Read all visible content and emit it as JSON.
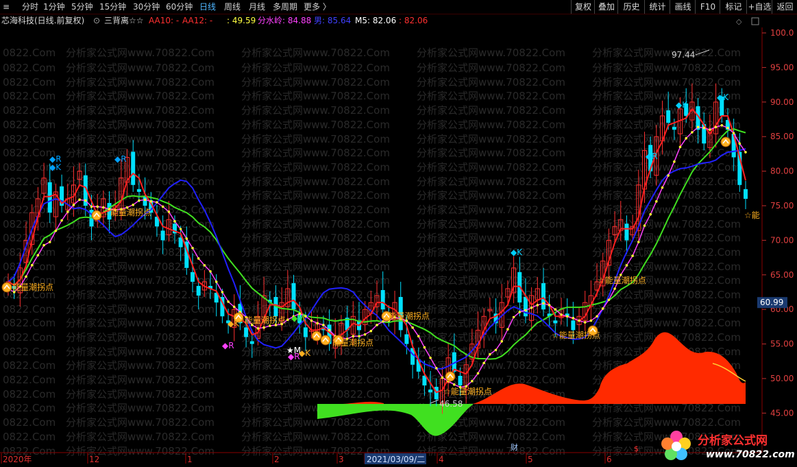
{
  "toolbar": {
    "tabs": [
      {
        "label": "分时",
        "active": false
      },
      {
        "label": "1分钟",
        "active": false
      },
      {
        "label": "5分钟",
        "active": false
      },
      {
        "label": "15分钟",
        "active": false
      },
      {
        "label": "30分钟",
        "active": false
      },
      {
        "label": "60分钟",
        "active": false
      },
      {
        "label": "日线",
        "active": true
      },
      {
        "label": "周线",
        "active": false
      },
      {
        "label": "月线",
        "active": false
      },
      {
        "label": "多周期",
        "active": false
      },
      {
        "label": "更多 〉",
        "active": false
      }
    ],
    "right_buttons": [
      "复权",
      "叠加",
      "历史",
      "统计",
      "画线",
      "F10",
      "标记",
      "+自选",
      "返回"
    ]
  },
  "info": {
    "stock": "芯海科技(日线.前复权)",
    "indicator": "三背离☆☆",
    "aa10": "AA10: -",
    "aa12": "AA12: -",
    "val1": ": 49.59",
    "fsl": "分水岭: 84.88",
    "v3": "男: 85.64",
    "m5": "M5: 82.06",
    "m5b": ": 82.06",
    "colors": {
      "stock": "#d8d8d8",
      "aa10": "#ff3030",
      "aa12": "#ff3030",
      "val1": "#ffff40",
      "fsl": "#ff40ff",
      "v3": "#4040ff",
      "m5": "#ffffff",
      "m5b": "#ff3030"
    }
  },
  "axis": {
    "ticks": [
      "100.0",
      "95.00",
      "90.00",
      "85.00",
      "80.00",
      "75.00",
      "70.00",
      "65.00",
      "60.00",
      "55.00",
      "50.00",
      "45.00"
    ],
    "current_price": "60.99",
    "y_range": [
      44,
      101
    ]
  },
  "dates": {
    "labels": [
      "2020年",
      "12",
      "1",
      "2",
      "3",
      "2021/03/09/二",
      "4",
      "5",
      "6"
    ],
    "markers": {
      "fin": "财",
      "s": "$"
    }
  },
  "annotations": {
    "high": "97.44",
    "low": "46.58",
    "turning_point": "能量潮拐点",
    "star_turning_point": "☆能量潮拐点",
    "marks": [
      "◆R",
      "◆K",
      "◆R",
      "◆R",
      "◆K",
      "◆M",
      "★M",
      "◆K",
      "◆R",
      "◆K",
      "◆K",
      "◆R",
      "◆K",
      "☆能"
    ]
  },
  "watermark": {
    "text": "分析家公式网www.70822.Com",
    "text_left": "0822.Com"
  },
  "logo": {
    "name": "分析家公式网",
    "url": "www.70822.com"
  },
  "colors": {
    "up": "#ff3030",
    "down": "#00e0ff",
    "grid": "#5a0000",
    "blue": "#2020ff",
    "green": "#40e020",
    "red": "#ff2020",
    "fill_red": "#ff2a00",
    "fill_green": "#40e020",
    "yellow": "#ffff30",
    "magenta": "#ff40ff"
  },
  "chart_data": {
    "type": "candlestick",
    "title": "芯海科技(日线.前复权)",
    "ylim": [
      44,
      101
    ],
    "x_labels": [
      "2020年",
      "12",
      "1",
      "2",
      "3",
      "2021/03/09/二",
      "4",
      "5",
      "6"
    ],
    "close": [
      64,
      63,
      66,
      70,
      74,
      76,
      79,
      74,
      77,
      75,
      76,
      78,
      80,
      75,
      72,
      74,
      76,
      73,
      75,
      79,
      82,
      78,
      77,
      75,
      74,
      72,
      70,
      73,
      71,
      69,
      66,
      64,
      62,
      64,
      63,
      61,
      59,
      58,
      60,
      58,
      56,
      55,
      59,
      62,
      61,
      59,
      61,
      63,
      60,
      58,
      56,
      57,
      58,
      57,
      55,
      56,
      58,
      57,
      59,
      57,
      60,
      61,
      62,
      60,
      59,
      61,
      57,
      55,
      52,
      51,
      49,
      48,
      47,
      50,
      53,
      51,
      49,
      52,
      55,
      57,
      59,
      60,
      58,
      61,
      63,
      66,
      61,
      59,
      62,
      63,
      60,
      59,
      58,
      60,
      59,
      57,
      59,
      61,
      62,
      64,
      67,
      70,
      72,
      73,
      70,
      72,
      78,
      83,
      80,
      85,
      88,
      87,
      86,
      89,
      88,
      90,
      86,
      84,
      86,
      90,
      88,
      86,
      82,
      78,
      76
    ],
    "max_high": 97.44,
    "min_low": 46.58,
    "current_price": 60.99
  }
}
